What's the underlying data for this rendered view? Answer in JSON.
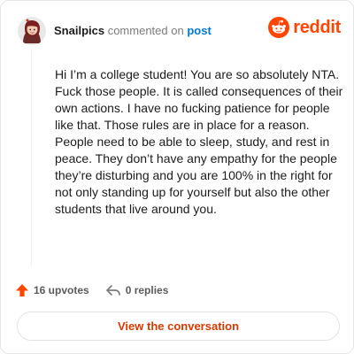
{
  "header": {
    "username": "Snailpics",
    "verb": "commented on",
    "object_link": "post",
    "avatar_icon": "user-avatar-icon"
  },
  "brand": {
    "name": "reddit",
    "logo_icon": "reddit-snoo-icon",
    "color": "#ff4500"
  },
  "comment": {
    "text": "Hi I’m a college student! You are so absolutely NTA. Fuck those people. It is called consequences of their own actions. I have no fucking patience for people like that. Those rules are in place for a reason. People need to be able to sleep, study, and rest in peace. They don’t have any empathy for the people they’re disturbing and you are 100% in the right for not only standing up for yourself but also the other students that live around you."
  },
  "actions": {
    "upvotes": "16 upvotes",
    "replies": "0 replies",
    "upvote_icon": "upvote-arrow-icon",
    "reply_icon": "reply-arrow-icon",
    "upvote_color": "#ff4500"
  },
  "cta": {
    "label": "View the conversation",
    "color": "#d93a00"
  }
}
